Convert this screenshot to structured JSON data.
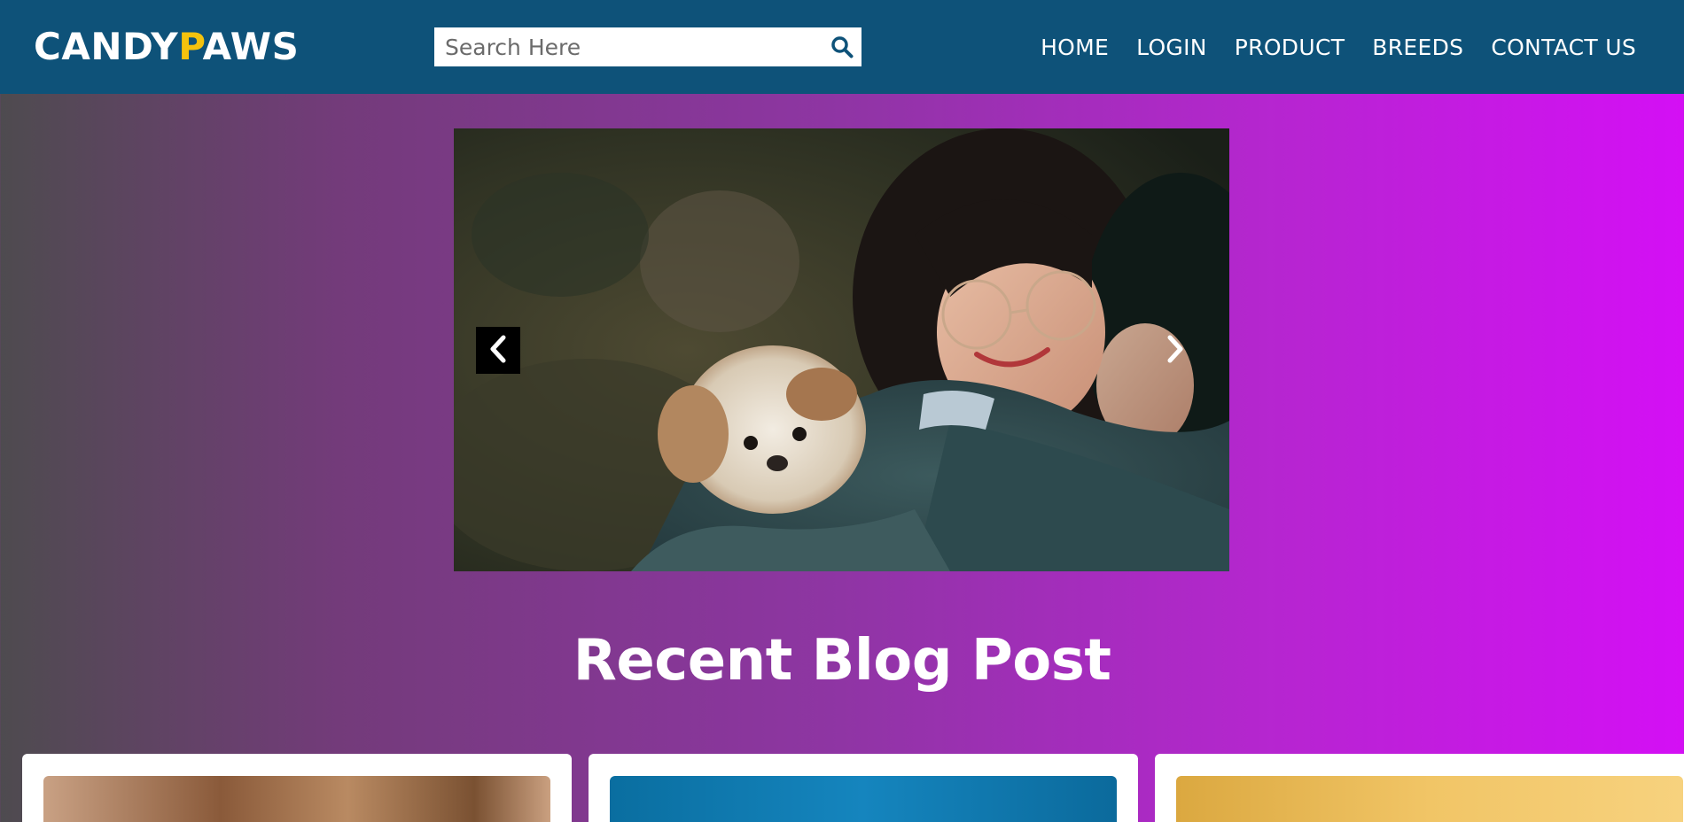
{
  "header": {
    "logo_part1": "CANDY",
    "logo_accent": "P",
    "logo_part2": "AWS",
    "accent_color": "#f4c20d",
    "background_color": "#0e5279",
    "search": {
      "placeholder": "Search Here",
      "icon": "search-icon"
    },
    "nav": [
      {
        "label": "HOME"
      },
      {
        "label": "LOGIN"
      },
      {
        "label": "PRODUCT"
      },
      {
        "label": "BREEDS"
      },
      {
        "label": "CONTACT US"
      }
    ]
  },
  "slider": {
    "prev_icon": "chevron-left-icon",
    "next_icon": "chevron-right-icon"
  },
  "blog": {
    "title": "Recent Blog Post",
    "cards": [
      {
        "id": "card-1"
      },
      {
        "id": "card-2"
      },
      {
        "id": "card-3"
      }
    ]
  }
}
